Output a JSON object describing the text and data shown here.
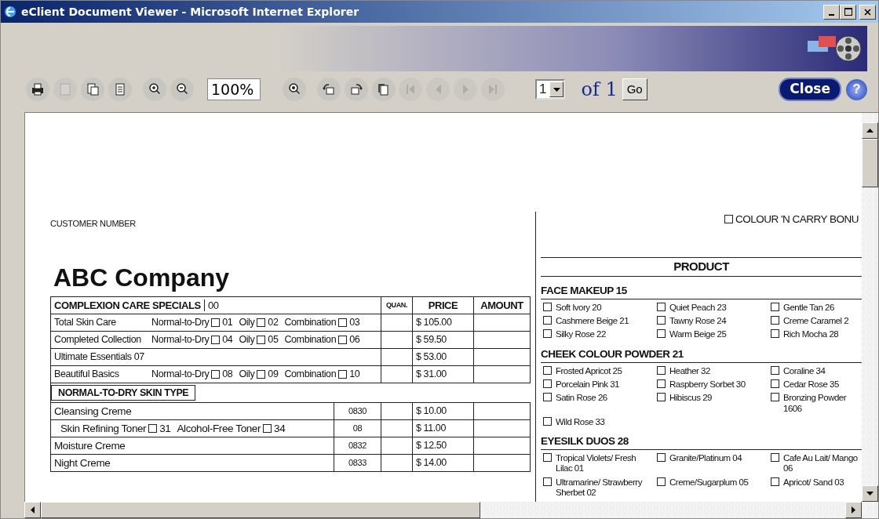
{
  "window": {
    "title": "eClient Document Viewer - Microsoft Internet Explorer"
  },
  "toolbar": {
    "tools": [
      {
        "kind": "print",
        "disabled": false
      },
      {
        "kind": "blank-page",
        "disabled": true
      },
      {
        "kind": "pages",
        "disabled": false
      },
      {
        "kind": "notes",
        "disabled": false
      },
      {
        "kind": "zoom-in",
        "disabled": false
      },
      {
        "kind": "zoom-out",
        "disabled": false
      },
      {
        "kind": "zoom-field",
        "value": "100%"
      },
      {
        "kind": "zoom-fit",
        "disabled": false
      },
      {
        "kind": "rotate-left",
        "disabled": false
      },
      {
        "kind": "rotate-right",
        "disabled": false
      },
      {
        "kind": "rotate-page",
        "disabled": false
      },
      {
        "kind": "first",
        "disabled": true
      },
      {
        "kind": "prev",
        "disabled": true
      },
      {
        "kind": "next",
        "disabled": true
      },
      {
        "kind": "last",
        "disabled": true
      }
    ],
    "page_select": {
      "value": "1"
    },
    "page_count": "of 1",
    "go_button": "Go",
    "close_button": "Close",
    "help_button": "?"
  },
  "document": {
    "customer_label": "CUSTOMER NUMBER",
    "company": "ABC Company",
    "table": {
      "heading": "COMPLEXION CARE SPECIALS",
      "heading_code": "00",
      "columns": [
        "QUAN.",
        "PRICE",
        "AMOUNT"
      ],
      "rows": [
        {
          "kind": "options",
          "name": "Total Skin Care",
          "options": [
            {
              "label": "Normal-to-Dry",
              "code": "01",
              "checked": false
            },
            {
              "label": "Oily",
              "code": "02",
              "checked": false
            },
            {
              "label": "Combination",
              "code": "03",
              "checked": false
            }
          ],
          "price": "$ 105.00"
        },
        {
          "kind": "options",
          "name": "Completed Collection",
          "options": [
            {
              "label": "Normal-to-Dry",
              "code": "04",
              "checked": false
            },
            {
              "label": "Oily",
              "code": "05",
              "checked": false
            },
            {
              "label": "Combination",
              "code": "06",
              "checked": false
            }
          ],
          "price": "$ 59.50"
        },
        {
          "kind": "simple",
          "name": "Ultimate Essentials 07",
          "price": "$ 53.00"
        },
        {
          "kind": "options",
          "name": "Beautiful Basics",
          "options": [
            {
              "label": "Normal-to-Dry",
              "code": "08",
              "checked": false
            },
            {
              "label": "Oily",
              "code": "09",
              "checked": false
            },
            {
              "label": "Combination",
              "code": "10",
              "checked": false
            }
          ],
          "price": "$ 31.00"
        },
        {
          "kind": "section",
          "name": "NORMAL-TO-DRY SKIN TYPE"
        },
        {
          "kind": "coded",
          "name": "Cleansing Creme",
          "code": "0830",
          "price": "$ 10.00"
        },
        {
          "kind": "coded",
          "options": [
            {
              "label": "Skin Refining Toner",
              "code": "31",
              "checked": false
            },
            {
              "label": "Alcohol-Free Toner",
              "code": "34",
              "checked": false
            }
          ],
          "code": "08",
          "price": "$ 11.00"
        },
        {
          "kind": "coded",
          "name": "Moisture Creme",
          "code": "0832",
          "price": "$ 12.50"
        },
        {
          "kind": "coded",
          "name": "Night Creme",
          "code": "0833",
          "price": "$ 14.00"
        }
      ]
    },
    "bonus": {
      "title": "COLOUR 'N CARRY BONU",
      "checked": false
    },
    "product_heading": "PRODUCT",
    "groups": [
      {
        "title": "FACE MAKEUP 15",
        "items": [
          {
            "label": "Soft Ivory 20",
            "checked": false
          },
          {
            "label": "Quiet Peach 23",
            "checked": false
          },
          {
            "label": "Gentle Tan 26",
            "checked": false
          },
          {
            "label": "Cashmere Beige 21",
            "checked": false
          },
          {
            "label": "Tawny Rose 24",
            "checked": false
          },
          {
            "label": "Creme Caramel 2",
            "checked": false
          },
          {
            "label": "Silky Rose 22",
            "checked": false
          },
          {
            "label": "Warm Beige 25",
            "checked": false
          },
          {
            "label": "Rich Mocha 28",
            "checked": false
          }
        ]
      },
      {
        "title": "CHEEK COLOUR POWDER 21",
        "items": [
          {
            "label": "Frosted Apricot 25",
            "checked": false
          },
          {
            "label": "Heather 32",
            "checked": false
          },
          {
            "label": "Coraline 34",
            "checked": false
          },
          {
            "label": "Porcelain Pink 31",
            "checked": false
          },
          {
            "label": "Raspberry Sorbet 30",
            "checked": false
          },
          {
            "label": "Cedar Rose 35",
            "checked": false
          },
          {
            "label": "Satin Rose 26",
            "checked": false
          },
          {
            "label": "Hibiscus 29",
            "checked": false
          },
          {
            "label": "Bronzing Powder 1606",
            "checked": false
          },
          {
            "label": "Wild Rose 33",
            "checked": false
          }
        ]
      },
      {
        "title": "EYESILK DUOS 28",
        "items": [
          {
            "label": "Tropical Violets/ Fresh Lilac 01",
            "checked": false
          },
          {
            "label": "Granite/Platinum 04",
            "checked": false
          },
          {
            "label": "Cafe Au Lait/ Mango 06",
            "checked": false
          },
          {
            "label": "Ultramarine/ Strawberry Sherbet 02",
            "checked": false
          },
          {
            "label": "Creme/Sugarplum 05",
            "checked": false
          },
          {
            "label": "Apricot/ Sand 03",
            "checked": false
          }
        ]
      }
    ]
  }
}
